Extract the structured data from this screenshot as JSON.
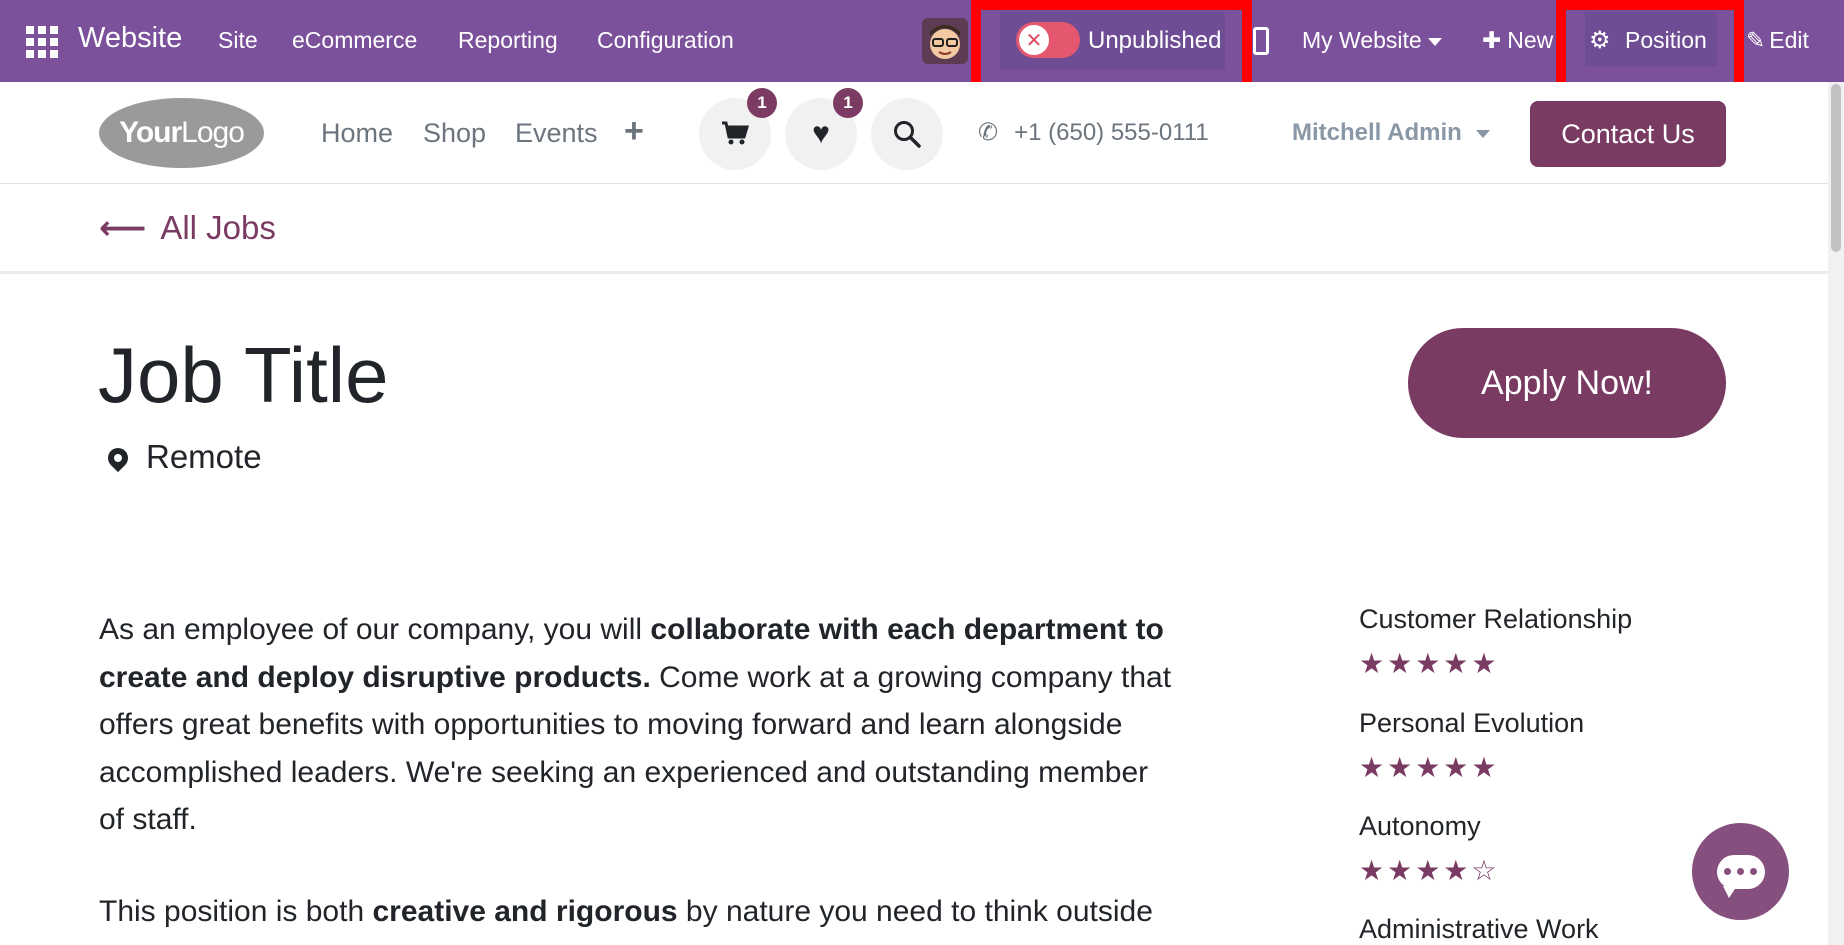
{
  "adminbar": {
    "brand": "Website",
    "menu": [
      "Site",
      "eCommerce",
      "Reporting",
      "Configuration"
    ],
    "publish_label": "Unpublished",
    "website_label": "My Website",
    "new_label": "New",
    "position_label": "Position",
    "edit_label": "Edit",
    "color": "#7c519c"
  },
  "header": {
    "logo_bold": "Your",
    "logo_light": "Logo",
    "nav": [
      "Home",
      "Shop",
      "Events"
    ],
    "cart_count": "1",
    "wishlist_count": "1",
    "phone": "+1 (650) 555-0111",
    "user": "Mitchell Admin",
    "contact_label": "Contact Us",
    "accent": "#7a3b63"
  },
  "breadcrumb": {
    "label": "All Jobs"
  },
  "job": {
    "title": "Job Title",
    "location": "Remote",
    "apply_label": "Apply Now!",
    "desc_p1_a": "As an employee of our company, you will ",
    "desc_p1_b": "collaborate with each department to create and deploy disruptive products.",
    "desc_p1_c": " Come work at a growing company that offers great benefits with opportunities to moving forward and learn alongside accomplished leaders. We're seeking an experienced and outstanding member of staff.",
    "desc_p2_a": "This position is both ",
    "desc_p2_b": "creative and rigorous",
    "desc_p2_c": " by nature you need to think outside"
  },
  "ratings": [
    {
      "name": "Customer Relationship",
      "stars": "★★★★★"
    },
    {
      "name": "Personal Evolution",
      "stars": "★★★★★"
    },
    {
      "name": "Autonomy",
      "stars": "★★★★☆"
    },
    {
      "name": "Administrative Work",
      "stars": ""
    }
  ]
}
